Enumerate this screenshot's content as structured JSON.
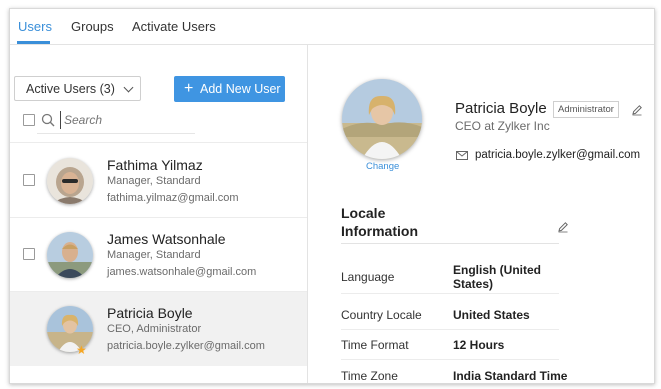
{
  "tabs": [
    {
      "label": "Users",
      "active": true
    },
    {
      "label": "Groups",
      "active": false
    },
    {
      "label": "Activate Users",
      "active": false
    }
  ],
  "filter": {
    "label": "Active Users (3)"
  },
  "add_user": {
    "label": "Add New User"
  },
  "search": {
    "placeholder": "Search"
  },
  "users": [
    {
      "name": "Fathima Yilmaz",
      "role": "Manager, Standard",
      "email": "fathima.yilmaz@gmail.com",
      "selected": false
    },
    {
      "name": "James Watsonhale",
      "role": "Manager, Standard",
      "email": "james.watsonhale@gmail.com",
      "selected": false
    },
    {
      "name": "Patricia Boyle",
      "role": "CEO, Administrator",
      "email": "patricia.boyle.zylker@gmail.com",
      "selected": true
    }
  ],
  "profile": {
    "name": "Patricia Boyle",
    "badge": "Administrator",
    "title": "CEO at Zylker Inc",
    "email": "patricia.boyle.zylker@gmail.com",
    "change_label": "Change"
  },
  "locale": {
    "title": "Locale Information",
    "rows": [
      {
        "label": "Language",
        "value": "English (United States)"
      },
      {
        "label": "Country Locale",
        "value": "United States"
      },
      {
        "label": "Time Format",
        "value": "12 Hours"
      },
      {
        "label": "Time Zone",
        "value": "India Standard Time"
      }
    ]
  },
  "colors": {
    "accent": "#3a8fd9",
    "button": "#3f95e2",
    "star": "#f5a623",
    "selected_row": "#f1f1f1"
  }
}
